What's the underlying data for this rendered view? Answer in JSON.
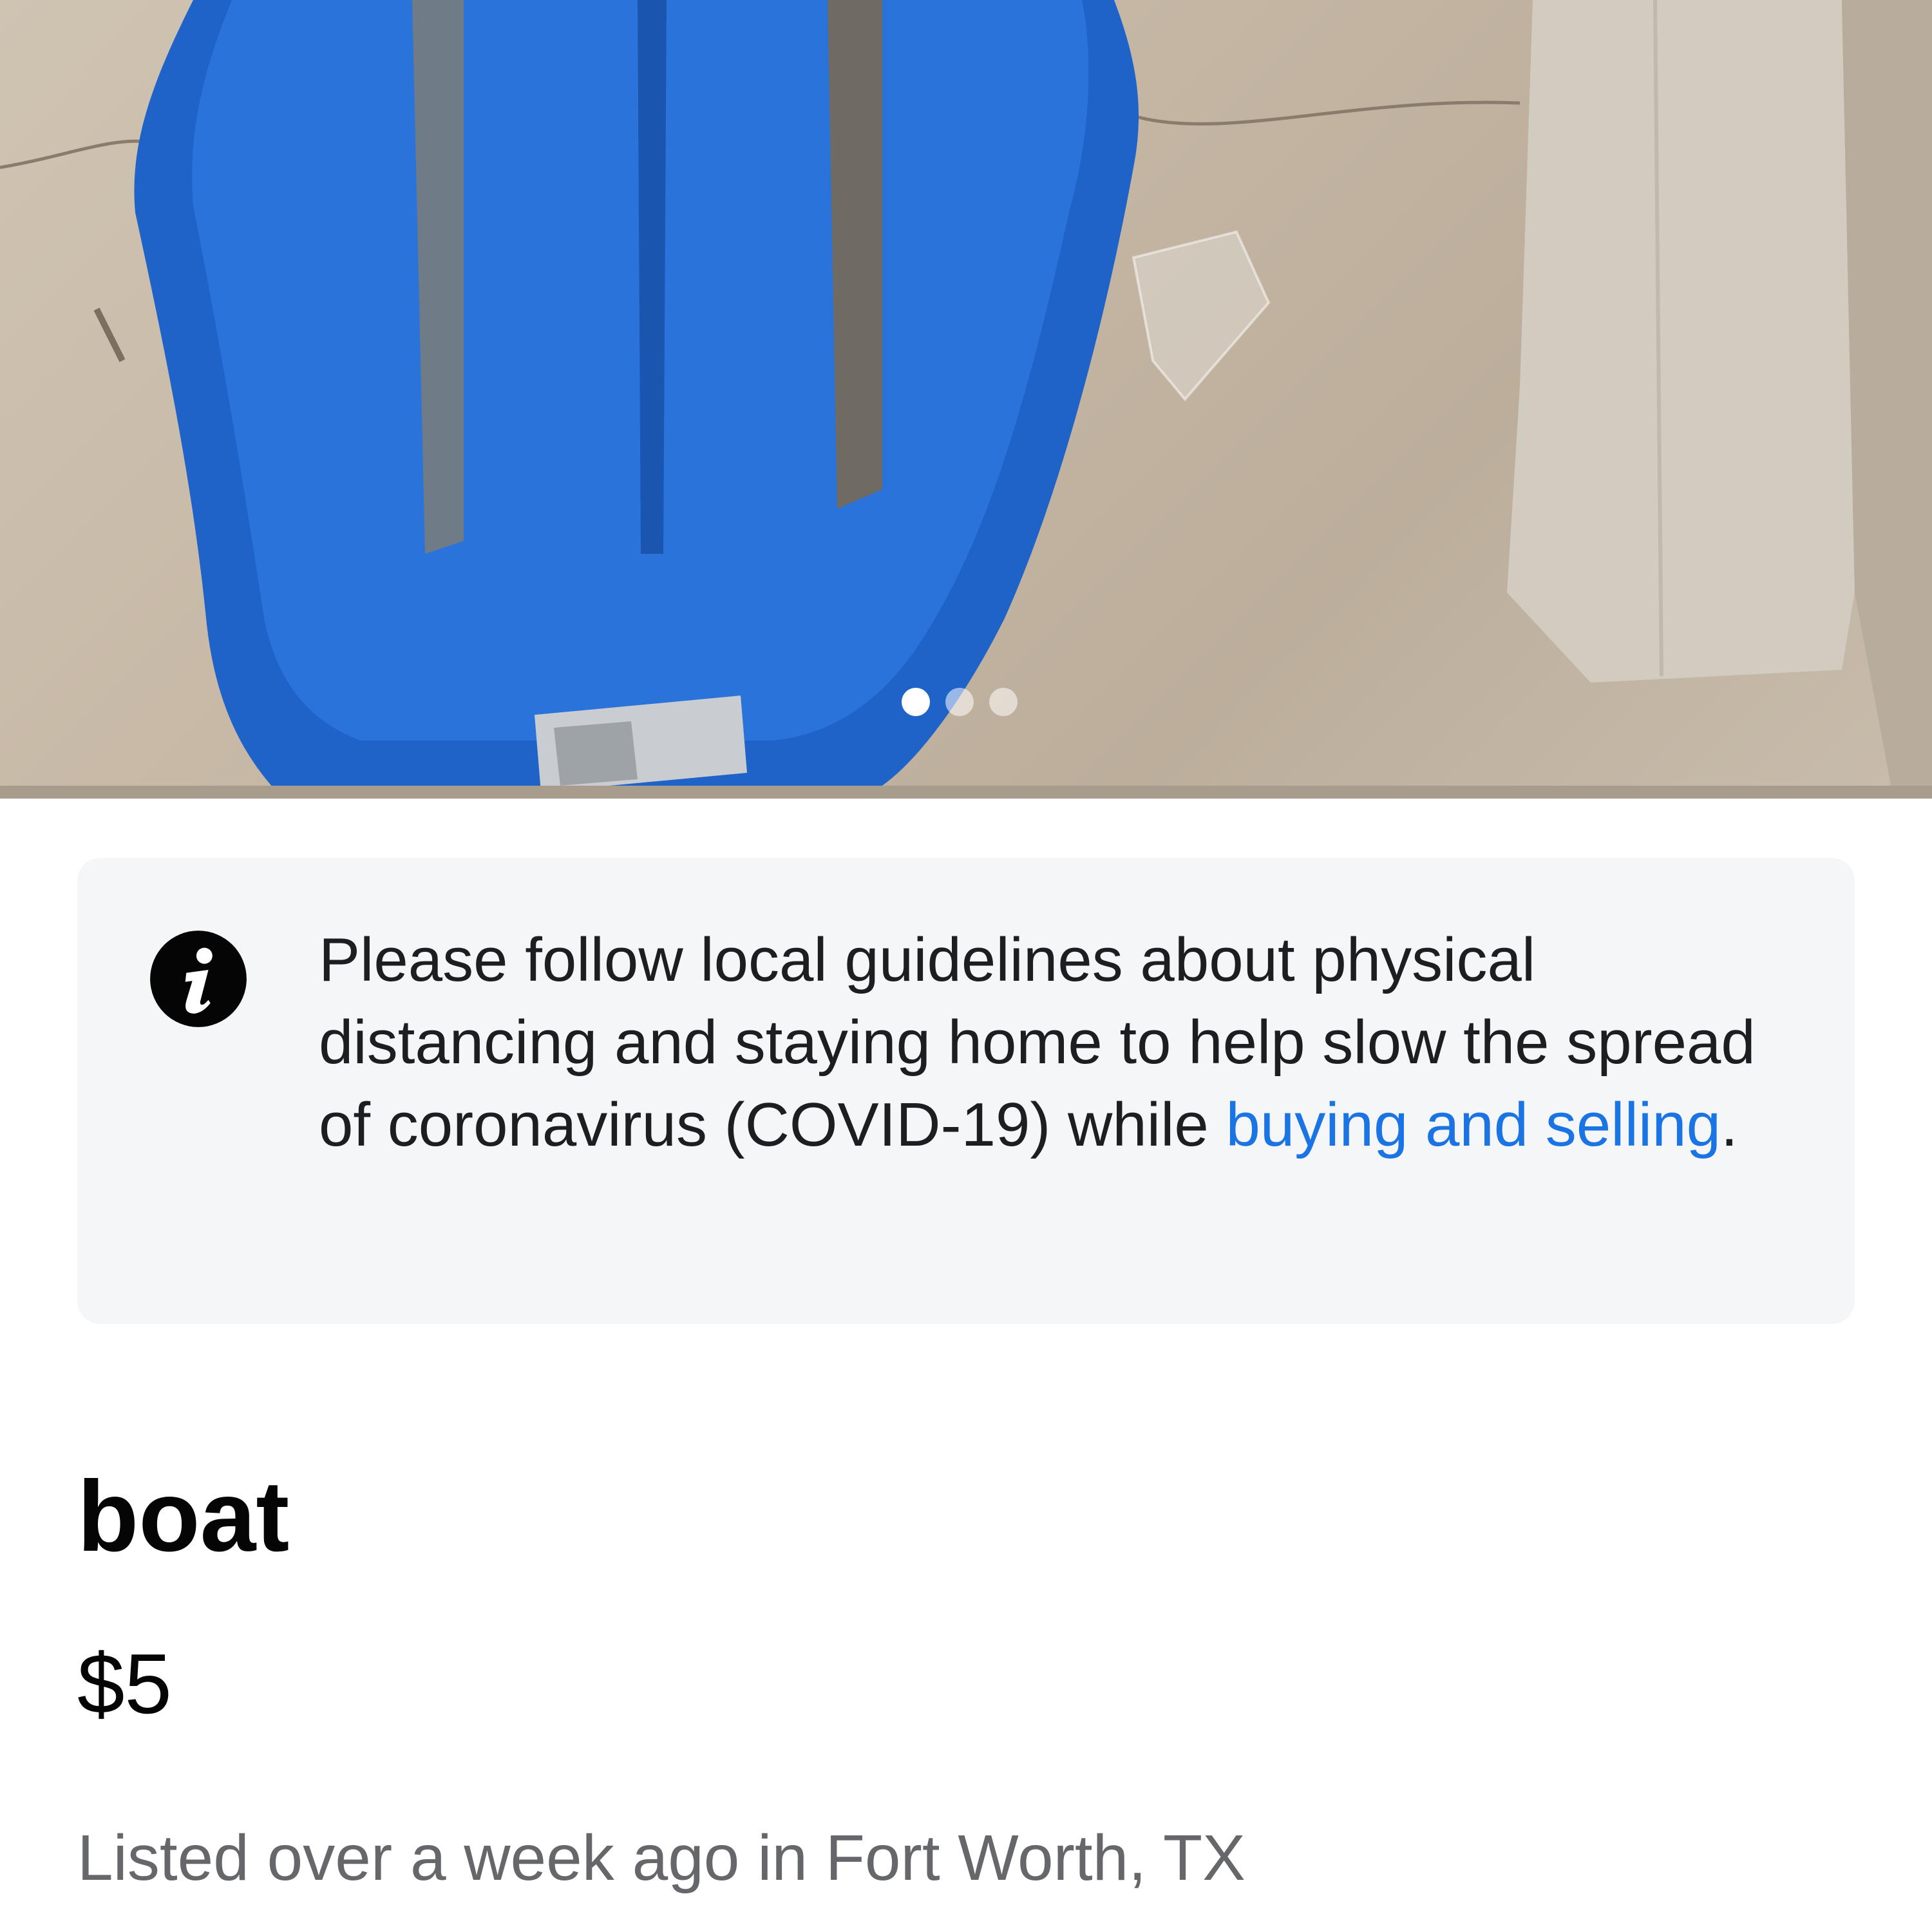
{
  "listing": {
    "photo": {
      "page_count": 3,
      "active_index": 0,
      "subject_color": "#1f63c9"
    },
    "notice": {
      "icon": "info-icon",
      "text": "Please follow local guidelines about physical distancing and staying home to help slow the spread of coronavirus (COVID-19) while",
      "link_text": "buying and selling",
      "trailing": ".",
      "link_color": "#1b74e4"
    },
    "title": "boat",
    "price": "$5",
    "meta": "Listed over a week ago in Fort Worth, TX"
  }
}
